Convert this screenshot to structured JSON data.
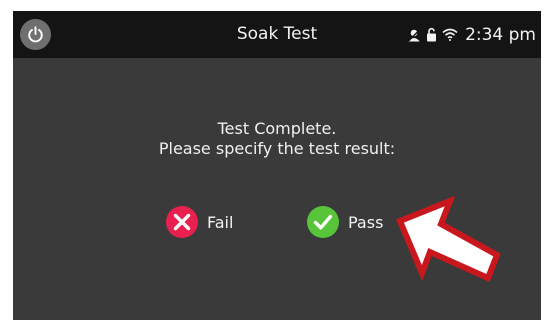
{
  "titlebar": {
    "title": "Soak Test",
    "power_icon": "power-icon",
    "status_icons": [
      "user-icon",
      "lock-icon",
      "wifi-icon"
    ],
    "clock": "2:34 pm"
  },
  "message": {
    "line1": "Test Complete.",
    "line2": "Please specify the test result:"
  },
  "choices": {
    "fail": {
      "label": "Fail",
      "icon": "x-circle-icon",
      "color": "#e8204f"
    },
    "pass": {
      "label": "Pass",
      "icon": "check-circle-icon",
      "color": "#58c43a"
    }
  },
  "annotation": {
    "arrow_color": "#c8181e",
    "arrow_icon": "arrow-pointer-icon"
  }
}
